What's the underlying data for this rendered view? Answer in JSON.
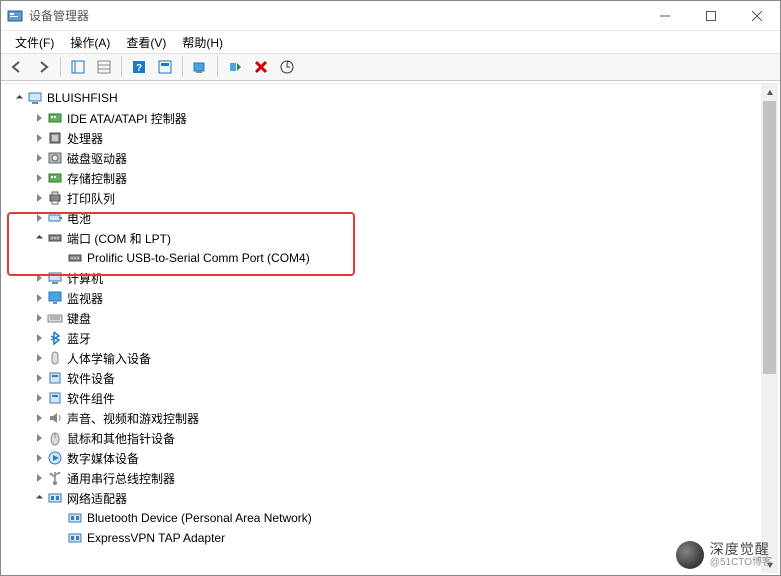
{
  "titlebar": {
    "title": "设备管理器"
  },
  "menu": {
    "file": "文件(F)",
    "action": "操作(A)",
    "view": "查看(V)",
    "help": "帮助(H)"
  },
  "tree": [
    {
      "level": 0,
      "exp": "open",
      "icon": "computer",
      "label": "BLUISHFISH"
    },
    {
      "level": 1,
      "exp": "closed",
      "icon": "controller",
      "label": "IDE ATA/ATAPI 控制器"
    },
    {
      "level": 1,
      "exp": "closed",
      "icon": "cpu",
      "label": "处理器"
    },
    {
      "level": 1,
      "exp": "closed",
      "icon": "disk",
      "label": "磁盘驱动器"
    },
    {
      "level": 1,
      "exp": "closed",
      "icon": "controller",
      "label": "存储控制器"
    },
    {
      "level": 1,
      "exp": "closed",
      "icon": "printer",
      "label": "打印队列"
    },
    {
      "level": 1,
      "exp": "closed",
      "icon": "battery",
      "label": "电池"
    },
    {
      "level": 1,
      "exp": "open",
      "icon": "port",
      "label": "端口 (COM 和 LPT)"
    },
    {
      "level": 2,
      "exp": "none",
      "icon": "port",
      "label": "Prolific USB-to-Serial Comm Port (COM4)"
    },
    {
      "level": 1,
      "exp": "closed",
      "icon": "computer",
      "label": "计算机"
    },
    {
      "level": 1,
      "exp": "closed",
      "icon": "monitor",
      "label": "监视器"
    },
    {
      "level": 1,
      "exp": "closed",
      "icon": "keyboard",
      "label": "键盘"
    },
    {
      "level": 1,
      "exp": "closed",
      "icon": "bluetooth",
      "label": "蓝牙"
    },
    {
      "level": 1,
      "exp": "closed",
      "icon": "hid",
      "label": "人体学输入设备"
    },
    {
      "level": 1,
      "exp": "closed",
      "icon": "software",
      "label": "软件设备"
    },
    {
      "level": 1,
      "exp": "closed",
      "icon": "software",
      "label": "软件组件"
    },
    {
      "level": 1,
      "exp": "closed",
      "icon": "sound",
      "label": "声音、视频和游戏控制器"
    },
    {
      "level": 1,
      "exp": "closed",
      "icon": "mouse",
      "label": "鼠标和其他指针设备"
    },
    {
      "level": 1,
      "exp": "closed",
      "icon": "media",
      "label": "数字媒体设备"
    },
    {
      "level": 1,
      "exp": "closed",
      "icon": "usb",
      "label": "通用串行总线控制器"
    },
    {
      "level": 1,
      "exp": "open",
      "icon": "network",
      "label": "网络适配器"
    },
    {
      "level": 2,
      "exp": "none",
      "icon": "network",
      "label": "Bluetooth Device (Personal Area Network)"
    },
    {
      "level": 2,
      "exp": "none",
      "icon": "network",
      "label": "ExpressVPN TAP Adapter"
    }
  ],
  "watermark": {
    "line1": "深度觉醒",
    "line2": "@51CTO博客"
  }
}
